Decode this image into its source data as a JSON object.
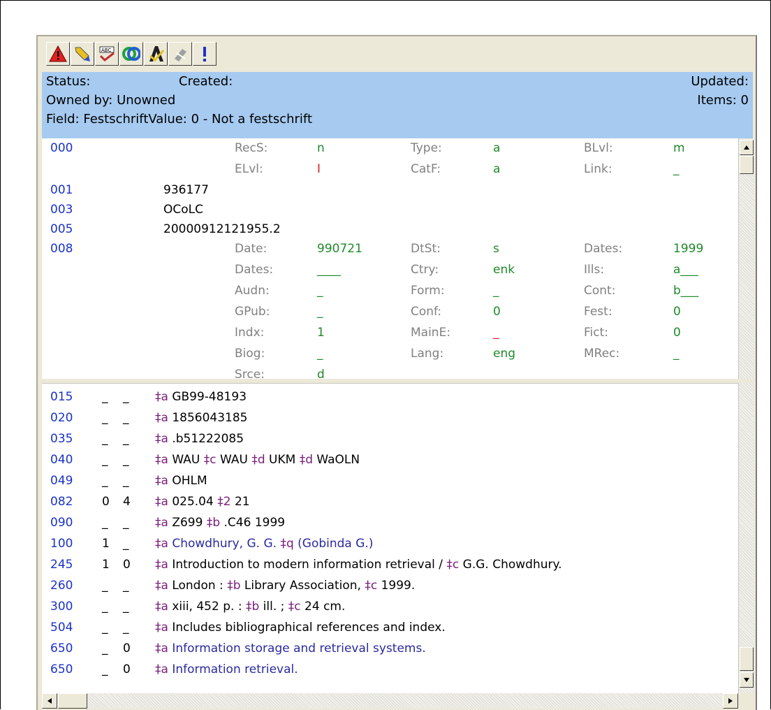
{
  "toolbar": {
    "buttons": [
      {
        "icon": "error-triangle-icon",
        "color": "#e02020"
      },
      {
        "icon": "highlighter-icon",
        "color": "#e8c020"
      },
      {
        "icon": "spellcheck-icon",
        "color": "#c03030"
      },
      {
        "icon": "connect-icon",
        "color": "#20a040"
      },
      {
        "icon": "validate-icon",
        "color": "#202020"
      },
      {
        "icon": "disabled-tool-icon",
        "color": "#a0a0a0"
      },
      {
        "icon": "exclamation-icon",
        "color": "#2030d0"
      }
    ]
  },
  "status": {
    "status_label": "Status:",
    "created_label": "Created:",
    "updated_label": "Updated:",
    "owned_by": "Owned by: Unowned",
    "items": "Items: 0",
    "field_info": "Field: FestschriftValue: 0 - Not a festschrift",
    "bg_color": "#a6caf0"
  },
  "fixed_fields": {
    "leader": {
      "tag": "000",
      "rows": [
        [
          {
            "l": "RecS:",
            "v": "n"
          },
          {
            "l": "Type:",
            "v": "a"
          },
          {
            "l": "BLvl:",
            "v": "m"
          }
        ],
        [
          {
            "l": "ELvl:",
            "v": "I"
          },
          {
            "l": "CatF:",
            "v": "a"
          },
          {
            "l": "Link:",
            "v": "_"
          }
        ]
      ]
    },
    "controls": [
      {
        "tag": "001",
        "value": "936177"
      },
      {
        "tag": "003",
        "value": "OCoLC"
      },
      {
        "tag": "005",
        "value": "20000912121955.2"
      }
    ],
    "f008": {
      "tag": "008",
      "rows": [
        [
          {
            "l": "Date:",
            "v": "990721"
          },
          {
            "l": "DtSt:",
            "v": "s"
          },
          {
            "l": "Dates:",
            "v": "1999"
          }
        ],
        [
          {
            "l": "Dates:",
            "v": "____"
          },
          {
            "l": "Ctry:",
            "v": "enk"
          },
          {
            "l": "Ills:",
            "v": "a___"
          }
        ],
        [
          {
            "l": "Audn:",
            "v": "_"
          },
          {
            "l": "Form:",
            "v": "_"
          },
          {
            "l": "Cont:",
            "v": "b___"
          }
        ],
        [
          {
            "l": "GPub:",
            "v": "_"
          },
          {
            "l": "Conf:",
            "v": "0"
          },
          {
            "l": "Fest:",
            "v": "0"
          }
        ],
        [
          {
            "l": "Indx:",
            "v": "1"
          },
          {
            "l": "MainE:",
            "v": "_"
          },
          {
            "l": "Fict:",
            "v": "0"
          }
        ],
        [
          {
            "l": "Biog:",
            "v": "_"
          },
          {
            "l": "Lang:",
            "v": "eng"
          },
          {
            "l": "MRec:",
            "v": "_"
          }
        ],
        [
          {
            "l": "Srce:",
            "v": "d"
          }
        ]
      ]
    }
  },
  "variable_fields": [
    {
      "tag": "015",
      "i1": "_",
      "i2": "_",
      "parts": [
        [
          "‡a",
          " GB99-48193"
        ]
      ]
    },
    {
      "tag": "020",
      "i1": "_",
      "i2": "_",
      "parts": [
        [
          "‡a",
          " 1856043185"
        ]
      ]
    },
    {
      "tag": "035",
      "i1": "_",
      "i2": "_",
      "parts": [
        [
          "‡a",
          " .b51222085"
        ]
      ]
    },
    {
      "tag": "040",
      "i1": "_",
      "i2": "_",
      "parts": [
        [
          "‡a",
          " WAU "
        ],
        [
          "‡c",
          " WAU "
        ],
        [
          "‡d",
          " UKM "
        ],
        [
          "‡d",
          " WaOLN"
        ]
      ]
    },
    {
      "tag": "049",
      "i1": "_",
      "i2": "_",
      "parts": [
        [
          "‡a",
          " OHLM"
        ]
      ]
    },
    {
      "tag": "082",
      "i1": "0",
      "i2": "4",
      "parts": [
        [
          "‡a",
          " 025.04 "
        ],
        [
          "‡2",
          " 21"
        ]
      ]
    },
    {
      "tag": "090",
      "i1": "_",
      "i2": "_",
      "parts": [
        [
          "‡a",
          " Z699 "
        ],
        [
          "‡b",
          " .C46 1999"
        ]
      ]
    },
    {
      "tag": "100",
      "i1": "1",
      "i2": "_",
      "linked": true,
      "parts": [
        [
          "‡a",
          " Chowdhury, G. G. "
        ],
        [
          "‡q",
          " (Gobinda G.)"
        ]
      ]
    },
    {
      "tag": "245",
      "i1": "1",
      "i2": "0",
      "parts": [
        [
          "‡a",
          " Introduction to modern information retrieval / "
        ],
        [
          "‡c",
          " G.G. Chowdhury."
        ]
      ]
    },
    {
      "tag": "260",
      "i1": "_",
      "i2": "_",
      "parts": [
        [
          "‡a",
          " London : "
        ],
        [
          "‡b",
          " Library Association, "
        ],
        [
          "‡c",
          " 1999."
        ]
      ]
    },
    {
      "tag": "300",
      "i1": "_",
      "i2": "_",
      "parts": [
        [
          "‡a",
          " xiii, 452 p. : "
        ],
        [
          "‡b",
          " ill. ; "
        ],
        [
          "‡c",
          " 24 cm."
        ]
      ]
    },
    {
      "tag": "504",
      "i1": "_",
      "i2": "_",
      "parts": [
        [
          "‡a",
          " Includes bibliographical references and index."
        ]
      ]
    },
    {
      "tag": "650",
      "i1": "_",
      "i2": "0",
      "linked": true,
      "parts": [
        [
          "‡a",
          " Information storage and retrieval systems."
        ]
      ]
    },
    {
      "tag": "650",
      "i1": "_",
      "i2": "0",
      "linked": true,
      "parts": [
        [
          "‡a",
          " Information retrieval."
        ]
      ]
    }
  ],
  "colors": {
    "tag": "#1a32c8",
    "linked_text": "#2a2aa0",
    "subfield": "#7a1e7a",
    "fixed_value": "#1f8a2a",
    "fixed_value_warn": "#d82020"
  }
}
